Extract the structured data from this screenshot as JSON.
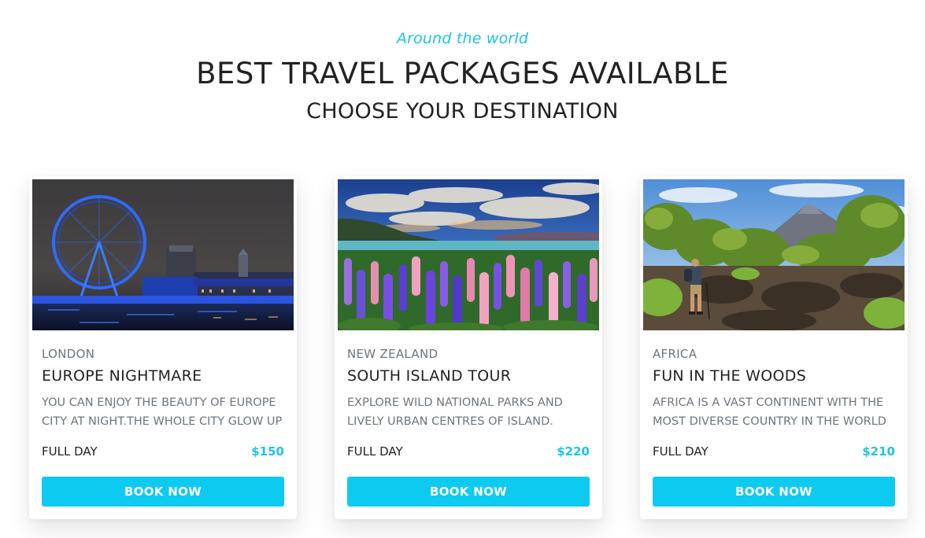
{
  "header": {
    "tagline": "Around the world",
    "title": "BEST TRAVEL PACKAGES AVAILABLE",
    "subtitle": "CHOOSE YOUR DESTINATION"
  },
  "colors": {
    "accent": "#0dcaf0",
    "price": "#1ec3e8"
  },
  "packages": [
    {
      "region": "LONDON",
      "title": "EUROPE NIGHTMARE",
      "description": "YOU CAN ENJOY THE BEAUTY OF EUROPE CITY AT NIGHT.THE WHOLE CITY GLOW UP",
      "duration": "FULL DAY",
      "price": "$150",
      "button": "BOOK NOW",
      "image": "london-eye-night-photo"
    },
    {
      "region": "NEW ZEALAND",
      "title": "SOUTH ISLAND TOUR",
      "description": "EXPLORE WILD NATIONAL PARKS AND LIVELY URBAN CENTRES OF ISLAND.",
      "duration": "FULL DAY",
      "price": "$220",
      "button": "BOOK NOW",
      "image": "lupin-lake-photo"
    },
    {
      "region": "AFRICA",
      "title": "FUN IN THE WOODS",
      "description": "AFRICA IS A VAST CONTINENT WITH THE MOST DIVERSE COUNTRY IN THE WORLD",
      "duration": "FULL DAY",
      "price": "$210",
      "button": "BOOK NOW",
      "image": "volcano-hiker-photo"
    }
  ]
}
